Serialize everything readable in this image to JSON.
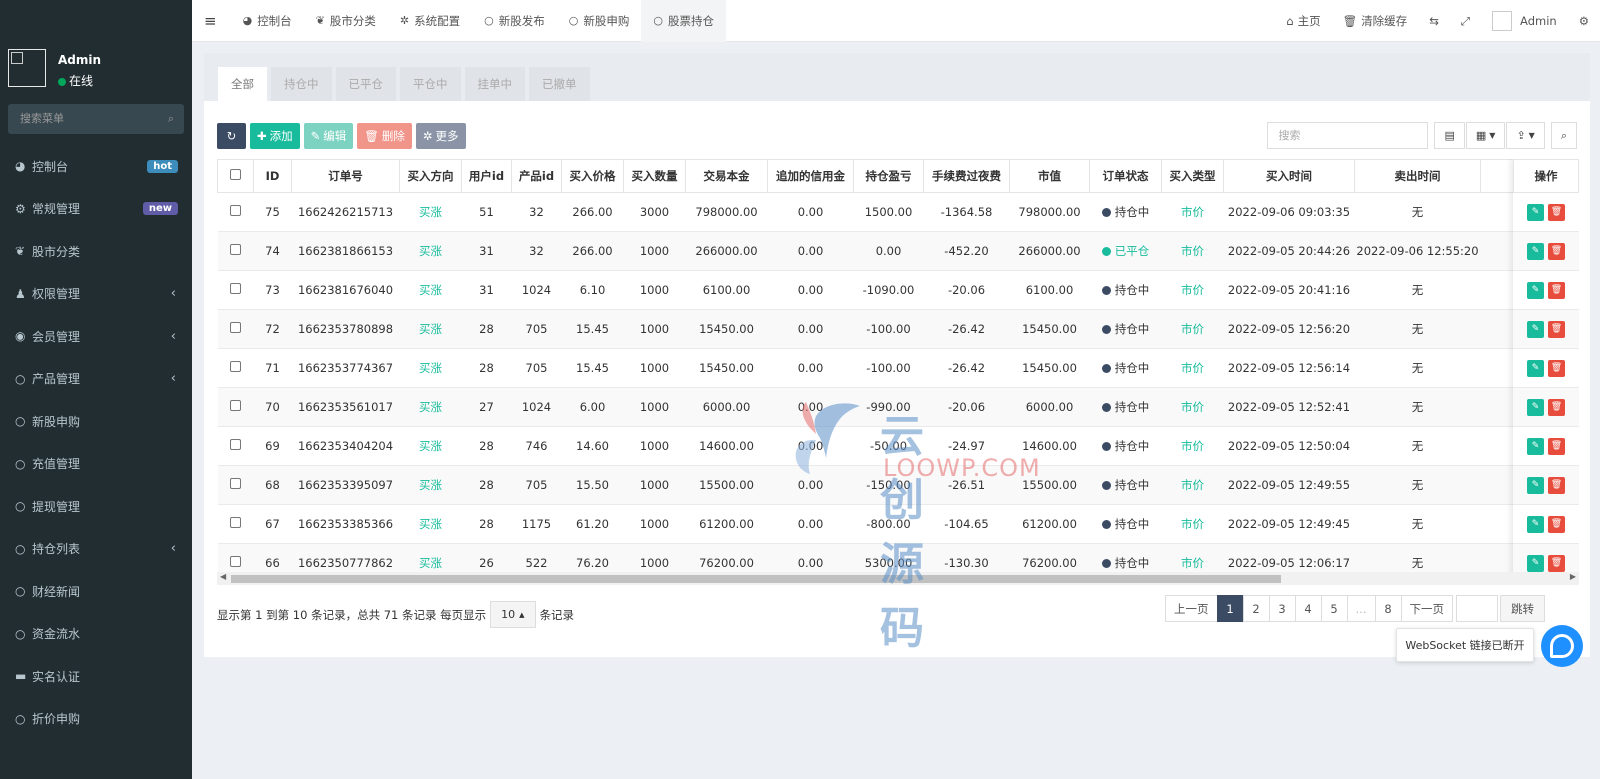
{
  "sidebar": {
    "user_name": "Admin",
    "user_status": "在线",
    "search_placeholder": "搜索菜单",
    "items": [
      {
        "label": "控制台",
        "icon": "dashboard-icon",
        "glyph": "◕",
        "badge": "hot",
        "badge_color": "#3c8dbc"
      },
      {
        "label": "常规管理",
        "icon": "cogs-icon",
        "glyph": "⚙",
        "badge": "new",
        "badge_color": "#605ca8"
      },
      {
        "label": "股市分类",
        "icon": "leaf-icon",
        "glyph": "❦"
      },
      {
        "label": "权限管理",
        "icon": "group-icon",
        "glyph": "♟",
        "arrow": "‹"
      },
      {
        "label": "会员管理",
        "icon": "user-circle-icon",
        "glyph": "◉",
        "arrow": "‹"
      },
      {
        "label": "产品管理",
        "icon": "circle-icon",
        "glyph": "○",
        "arrow": "‹"
      },
      {
        "label": "新股申购",
        "icon": "circle-icon",
        "glyph": "○"
      },
      {
        "label": "充值管理",
        "icon": "circle-icon",
        "glyph": "○"
      },
      {
        "label": "提现管理",
        "icon": "circle-icon",
        "glyph": "○"
      },
      {
        "label": "持仓列表",
        "icon": "circle-icon",
        "glyph": "○",
        "arrow": "‹"
      },
      {
        "label": "财经新闻",
        "icon": "circle-icon",
        "glyph": "○"
      },
      {
        "label": "资金流水",
        "icon": "circle-icon",
        "glyph": "○"
      },
      {
        "label": "实名认证",
        "icon": "credit-card-icon",
        "glyph": "▬"
      },
      {
        "label": "折价申购",
        "icon": "circle-icon",
        "glyph": "○"
      }
    ]
  },
  "topbar": {
    "tabs": [
      {
        "label": "控制台",
        "icon": "dashboard-icon",
        "glyph": "◕"
      },
      {
        "label": "股市分类",
        "icon": "leaf-icon",
        "glyph": "❦"
      },
      {
        "label": "系统配置",
        "icon": "gear-icon",
        "glyph": "✲"
      },
      {
        "label": "新股发布",
        "icon": "circle-icon",
        "glyph": "○"
      },
      {
        "label": "新股申购",
        "icon": "circle-icon",
        "glyph": "○"
      },
      {
        "label": "股票持仓",
        "icon": "circle-icon",
        "glyph": "○",
        "active": true
      }
    ],
    "home": "主页",
    "clear_cache": "清除缓存",
    "admin": "Admin"
  },
  "status_tabs": [
    "全部",
    "持仓中",
    "已平仓",
    "平仓中",
    "挂单中",
    "已撤单"
  ],
  "toolbar": {
    "add": "添加",
    "edit": "编辑",
    "delete": "删除",
    "more": "更多",
    "search_placeholder": "搜索"
  },
  "table": {
    "headers": [
      "ID",
      "订单号",
      "买入方向",
      "用户id",
      "产品id",
      "买入价格",
      "买入数量",
      "交易本金",
      "追加的信用金",
      "持仓盈亏",
      "手续费过夜费",
      "市值",
      "订单状态",
      "买入类型",
      "买入时间",
      "卖出时间"
    ],
    "op_header": "操作",
    "rows": [
      [
        "75",
        "1662426215713",
        "买涨",
        "51",
        "32",
        "266.00",
        "3000",
        "798000.00",
        "0.00",
        "1500.00",
        "-1364.58",
        "798000.00",
        "持仓中",
        "市价",
        "2022-09-06 09:03:35",
        "无"
      ],
      [
        "74",
        "1662381866153",
        "买涨",
        "31",
        "32",
        "266.00",
        "1000",
        "266000.00",
        "0.00",
        "0.00",
        "-452.20",
        "266000.00",
        "已平仓",
        "市价",
        "2022-09-05 20:44:26",
        "2022-09-06 12:55:20"
      ],
      [
        "73",
        "1662381676040",
        "买涨",
        "31",
        "1024",
        "6.10",
        "1000",
        "6100.00",
        "0.00",
        "-1090.00",
        "-20.06",
        "6100.00",
        "持仓中",
        "市价",
        "2022-09-05 20:41:16",
        "无"
      ],
      [
        "72",
        "1662353780898",
        "买涨",
        "28",
        "705",
        "15.45",
        "1000",
        "15450.00",
        "0.00",
        "-100.00",
        "-26.42",
        "15450.00",
        "持仓中",
        "市价",
        "2022-09-05 12:56:20",
        "无"
      ],
      [
        "71",
        "1662353774367",
        "买涨",
        "28",
        "705",
        "15.45",
        "1000",
        "15450.00",
        "0.00",
        "-100.00",
        "-26.42",
        "15450.00",
        "持仓中",
        "市价",
        "2022-09-05 12:56:14",
        "无"
      ],
      [
        "70",
        "1662353561017",
        "买涨",
        "27",
        "1024",
        "6.00",
        "1000",
        "6000.00",
        "0.00",
        "-990.00",
        "-20.06",
        "6000.00",
        "持仓中",
        "市价",
        "2022-09-05 12:52:41",
        "无"
      ],
      [
        "69",
        "1662353404204",
        "买涨",
        "28",
        "746",
        "14.60",
        "1000",
        "14600.00",
        "0.00",
        "-50.00",
        "-24.97",
        "14600.00",
        "持仓中",
        "市价",
        "2022-09-05 12:50:04",
        "无"
      ],
      [
        "68",
        "1662353395097",
        "买涨",
        "28",
        "705",
        "15.50",
        "1000",
        "15500.00",
        "0.00",
        "-150.00",
        "-26.51",
        "15500.00",
        "持仓中",
        "市价",
        "2022-09-05 12:49:55",
        "无"
      ],
      [
        "67",
        "1662353385366",
        "买涨",
        "28",
        "1175",
        "61.20",
        "1000",
        "61200.00",
        "0.00",
        "-800.00",
        "-104.65",
        "61200.00",
        "持仓中",
        "市价",
        "2022-09-05 12:49:45",
        "无"
      ],
      [
        "66",
        "1662350777862",
        "买涨",
        "26",
        "522",
        "76.20",
        "1000",
        "76200.00",
        "0.00",
        "5300.00",
        "-130.30",
        "76200.00",
        "持仓中",
        "市价",
        "2022-09-05 12:06:17",
        "无"
      ]
    ]
  },
  "pagination": {
    "info_prefix": "显示第 1 到第 10 条记录，总共 71 条记录 每页显示",
    "page_size": "10",
    "info_suffix": "条记录",
    "prev": "上一页",
    "pages": [
      "1",
      "2",
      "3",
      "4",
      "5",
      "...",
      "8"
    ],
    "next": "下一页",
    "jump": "跳转"
  },
  "tooltip": "WebSocket 链接已断开",
  "watermark": {
    "text": "云创源码",
    "sub": "LOOWP.COM"
  },
  "colors": {
    "sidebar_bg": "#222d32",
    "green": "#18bc9c",
    "status_holding": "#3c4b64",
    "status_closed": "#18bc9c",
    "btn_refresh": "#3c4b64",
    "btn_add": "#18bc9c",
    "btn_edit": "#7dd3c1",
    "btn_delete": "#f1948a",
    "btn_more": "#8a94a6",
    "op_edit": "#18bc9c",
    "op_del": "#e74c3c"
  }
}
